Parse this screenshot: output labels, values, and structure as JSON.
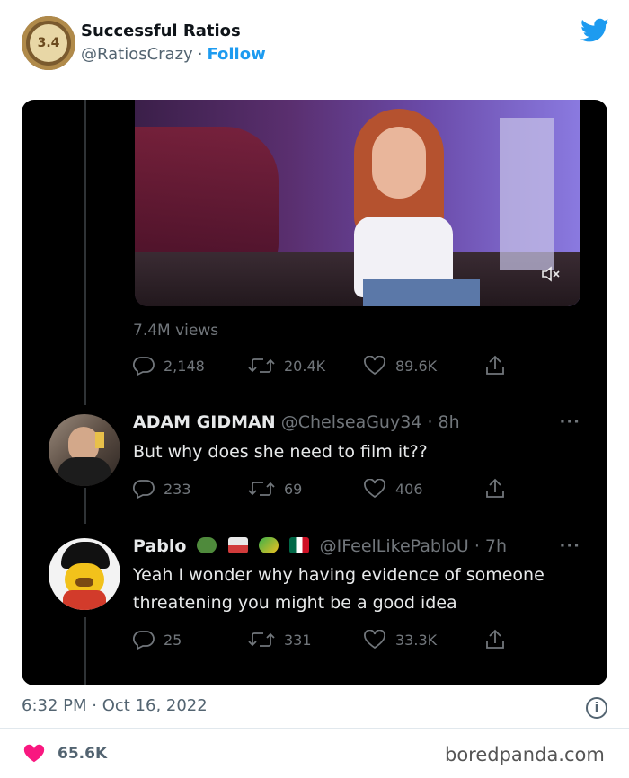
{
  "tweet": {
    "avatar_text": "3.4",
    "account_name": "Successful Ratios",
    "handle": "@RatiosCrazy",
    "separator": "·",
    "follow_label": "Follow",
    "timestamp": "6:32 PM · Oct 16, 2022",
    "like_count": "65.6K",
    "icons": {
      "brand": "twitter-bird-icon",
      "info": "info-icon",
      "like": "heart-icon"
    }
  },
  "embedded": {
    "views": "7.4M views",
    "video_mute_icon": "mute-icon",
    "original_stats": {
      "replies": "2,148",
      "retweets": "20.4K",
      "likes": "89.6K"
    },
    "replies": [
      {
        "name": "ADAM GIDMAN",
        "handle": "@ChelseaGuy34",
        "time": "· 8h",
        "text": "But why does she need to film it??",
        "stats": {
          "replies": "233",
          "retweets": "69",
          "likes": "406"
        }
      },
      {
        "name": "Pablo",
        "handle": "@IFeelLikePabloU",
        "time": "· 7h",
        "text": "Yeah I wonder why having evidence of someone threatening you might be a good idea",
        "stats": {
          "replies": "25",
          "retweets": "331",
          "likes": "33.3K"
        },
        "name_emojis": [
          "frog-emoji",
          "skier-emoji",
          "parrot-emoji",
          "mexico-flag-emoji"
        ]
      }
    ],
    "more_label": "···"
  },
  "watermark": "boredpanda.com",
  "colors": {
    "accent": "#1d9bf0",
    "like": "#f91880",
    "card_bg": "#000000",
    "muted": "#71767b"
  }
}
